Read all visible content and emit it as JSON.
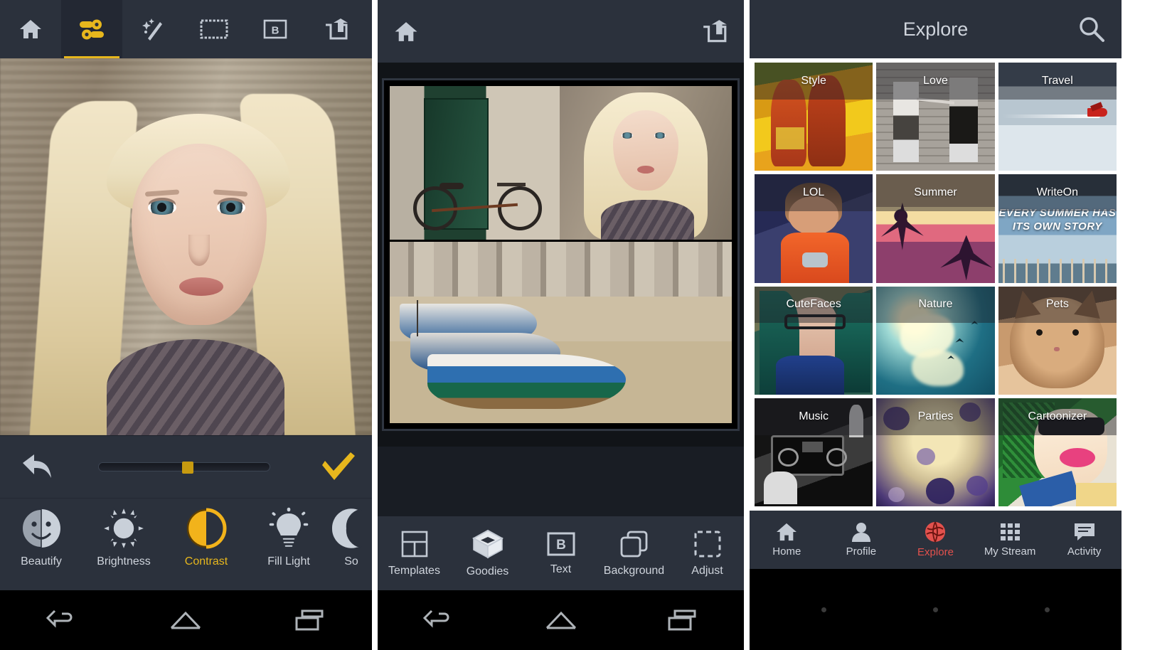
{
  "panel1": {
    "name": "photo-editor",
    "toolbar": [
      {
        "icon": "home-icon",
        "label": "Home",
        "active": false
      },
      {
        "icon": "sliders-icon",
        "label": "Adjust",
        "active": true
      },
      {
        "icon": "magic-wand-icon",
        "label": "Effects",
        "active": false
      },
      {
        "icon": "frame-icon",
        "label": "Frames",
        "active": false
      },
      {
        "icon": "text-b-icon",
        "label": "Text",
        "active": false
      },
      {
        "icon": "share-icon",
        "label": "Share",
        "active": false
      }
    ],
    "slider": {
      "value": 52,
      "min": 0,
      "max": 100
    },
    "undo_icon": "undo-arrow-icon",
    "confirm_icon": "checkmark-icon",
    "tools": [
      {
        "label": "Beautify",
        "icon": "beautify-face-icon",
        "active": false
      },
      {
        "label": "Brightness",
        "icon": "sun-icon",
        "active": false
      },
      {
        "label": "Contrast",
        "icon": "contrast-circle-icon",
        "active": true
      },
      {
        "label": "Fill Light",
        "icon": "lightbulb-icon",
        "active": false
      },
      {
        "label": "So",
        "icon": "soften-icon",
        "active": false
      }
    ]
  },
  "panel2": {
    "name": "collage-editor",
    "topbar": {
      "home_icon": "home-icon",
      "share_icon": "share-icon"
    },
    "bottom_items": [
      {
        "label": "Templates",
        "icon": "grid-layout-icon"
      },
      {
        "label": "Goodies",
        "icon": "box-icon"
      },
      {
        "label": "Text",
        "icon": "text-b-icon"
      },
      {
        "label": "Background",
        "icon": "layers-icon"
      },
      {
        "label": "Adjust",
        "icon": "crop-dashed-icon"
      }
    ]
  },
  "panel3": {
    "name": "explore-feed",
    "header": {
      "title": "Explore",
      "search_icon": "search-icon"
    },
    "accent_color": "#e2514d",
    "tiles": [
      {
        "label": "Style",
        "art": "style"
      },
      {
        "label": "Love",
        "art": "love"
      },
      {
        "label": "Travel",
        "art": "travel"
      },
      {
        "label": "LOL",
        "art": "lol"
      },
      {
        "label": "Summer",
        "art": "summer"
      },
      {
        "label": "WriteOn",
        "art": "writeon",
        "overlay_text": "EVERY SUMMER HAS ITS OWN STORY"
      },
      {
        "label": "CuteFaces",
        "art": "cutefaces"
      },
      {
        "label": "Nature",
        "art": "nature"
      },
      {
        "label": "Pets",
        "art": "pets"
      },
      {
        "label": "Music",
        "art": "music"
      },
      {
        "label": "Parties",
        "art": "parties"
      },
      {
        "label": "Cartoonizer",
        "art": "cartoonizer"
      }
    ],
    "nav": [
      {
        "label": "Home",
        "icon": "home-icon",
        "active": false
      },
      {
        "label": "Profile",
        "icon": "person-icon",
        "active": false
      },
      {
        "label": "Explore",
        "icon": "globe-icon",
        "active": true
      },
      {
        "label": "My Stream",
        "icon": "grid-dots-icon",
        "active": false
      },
      {
        "label": "Activity",
        "icon": "chat-icon",
        "active": false
      }
    ]
  },
  "android_nav": {
    "back_icon": "back-arrow-icon",
    "home_icon": "home-outline-icon",
    "recents_icon": "recents-icon"
  }
}
